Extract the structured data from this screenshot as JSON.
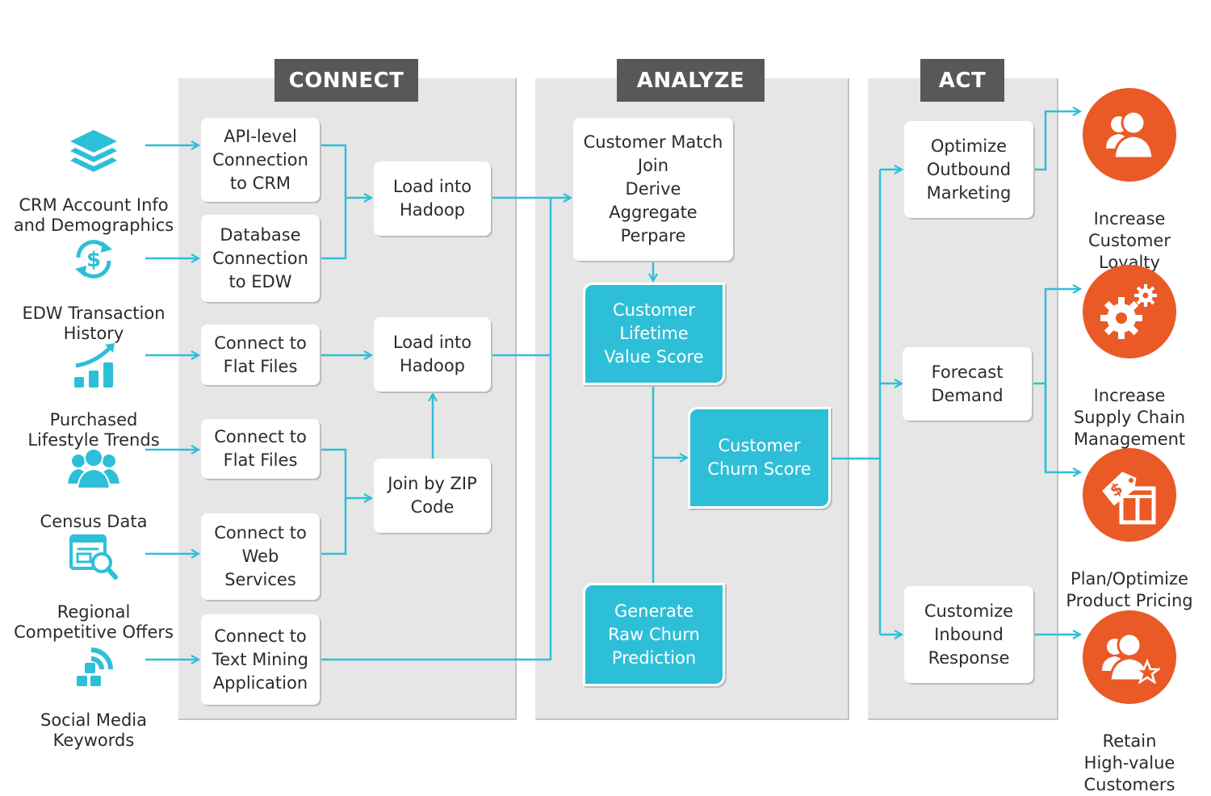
{
  "phases": {
    "connect": "CONNECT",
    "analyze": "ANALYZE",
    "act": "ACT"
  },
  "sources": [
    {
      "icon": "layers-icon",
      "label": "CRM Account Info\nand Demographics"
    },
    {
      "icon": "dollar-refresh-icon",
      "label": "EDW Transaction\nHistory"
    },
    {
      "icon": "growth-chart-icon",
      "label": "Purchased\nLifestyle Trends"
    },
    {
      "icon": "people-group-icon",
      "label": "Census Data"
    },
    {
      "icon": "browser-search-icon",
      "label": "Regional\nCompetitive Offers"
    },
    {
      "icon": "social-feed-icon",
      "label": "Social Media\nKeywords"
    }
  ],
  "connect_steps": [
    "API-level\nConnection\nto CRM",
    "Database\nConnection\nto EDW",
    "Connect to\nFlat Files",
    "Connect to\nFlat Files",
    "Connect to\nWeb\nServices",
    "Connect to\nText Mining\nApplication"
  ],
  "load_steps": [
    "Load into\nHadoop",
    "Load into\nHadoop",
    "Join by ZIP\nCode"
  ],
  "analyze_steps": {
    "prepare": "Customer Match\nJoin\nDerive\nAggregate\nPerpare",
    "lifetime_value": "Customer\nLifetime\nValue Score",
    "churn_score": "Customer\nChurn Score",
    "raw_churn": "Generate\nRaw Churn\nPrediction"
  },
  "act_steps": [
    "Optimize\nOutbound\nMarketing",
    "Forecast\nDemand",
    "Customize\nInbound\nResponse"
  ],
  "outcomes": [
    {
      "icon": "customers-icon",
      "label": "Increase\nCustomer\nLoyalty"
    },
    {
      "icon": "gears-icon",
      "label": "Increase\nSupply Chain\nManagement"
    },
    {
      "icon": "price-tag-icon",
      "label": "Plan/Optimize\nProduct Pricing"
    },
    {
      "icon": "customers-star-icon",
      "label": "Retain\nHigh-value\nCustomers"
    }
  ],
  "colors": {
    "accent": "#2ebfd8",
    "outcome": "#ea5a27",
    "phase_header": "#58585a",
    "panel": "#e6e6e6"
  }
}
